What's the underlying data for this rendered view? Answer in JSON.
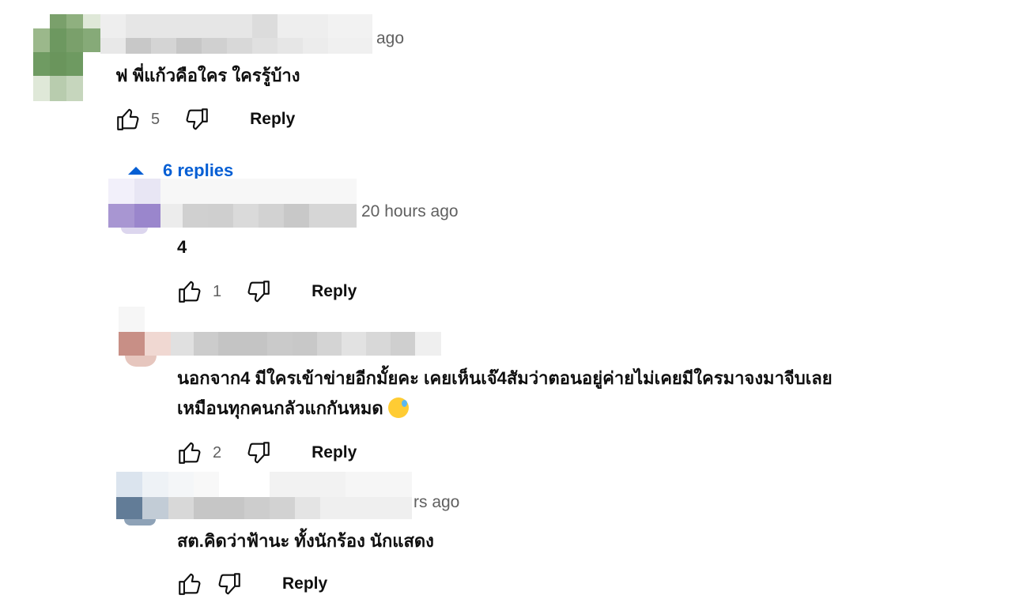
{
  "comments": [
    {
      "timestamp": "ago",
      "text": "ฟ พี่แก้วคือใคร ใครรู้บ้าง",
      "likes": "5",
      "reply_label": "Reply"
    },
    {
      "timestamp": "20 hours ago",
      "text": "4",
      "likes": "1",
      "reply_label": "Reply"
    },
    {
      "text_line1": "นอกจาก4 มีใครเข้าข่ายอีกมั้ยคะ เคยเห็นเจ๊4สัมว่าตอนอยู่ค่ายไม่เคยมีใครมาจงมาจีบเลย",
      "text_line2": "เหมือนทุกคนกลัวแกกันหมด",
      "emoji": "sweat-smile-emoji",
      "likes": "2",
      "reply_label": "Reply"
    },
    {
      "timestamp": "rs ago",
      "text": "สต.คิดว่าฟ้านะ ทั้งนักร้อง นักแสดง",
      "likes": "",
      "reply_label": "Reply"
    }
  ],
  "replies_toggle": {
    "label": "6 replies"
  },
  "icons": {
    "like": "thumbs-up-icon",
    "dislike": "thumbs-down-icon",
    "collapse": "caret-up-icon"
  },
  "colors": {
    "link": "#065fd4",
    "secondary_text": "#606060",
    "primary_text": "#0f0f0f"
  }
}
